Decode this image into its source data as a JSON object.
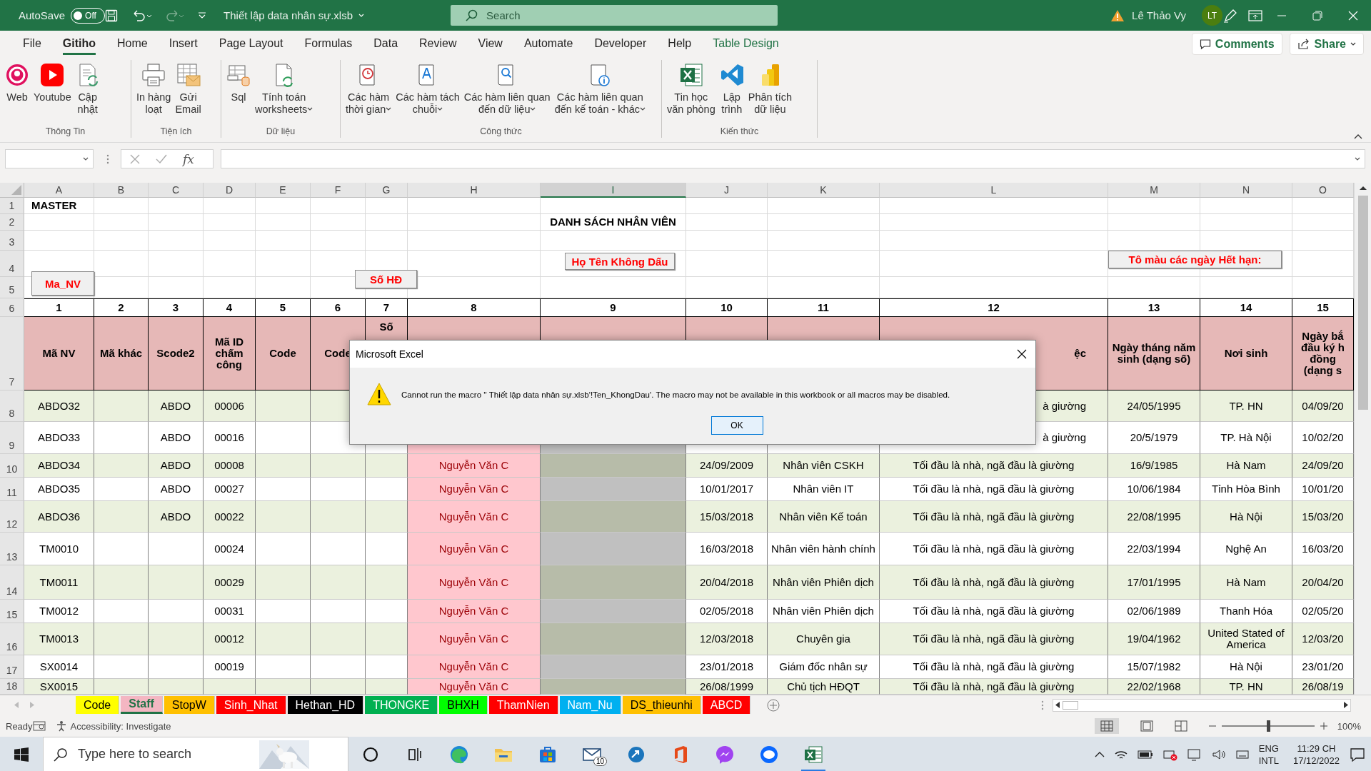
{
  "title_bar": {
    "autosave_label": "AutoSave",
    "autosave": {
      "on": false,
      "label": "Off"
    },
    "document_title": "Thiết lập data nhân sự.xlsb",
    "search": {
      "placeholder": "Search"
    },
    "user_name": "Lê Thảo Vy",
    "avatar_initials": "LT"
  },
  "ribbon_tabs": [
    {
      "label": "File",
      "selected": false,
      "kind": "normal"
    },
    {
      "label": "Gitiho",
      "selected": true,
      "kind": "normal"
    },
    {
      "label": "Home",
      "selected": false,
      "kind": "normal"
    },
    {
      "label": "Insert",
      "selected": false,
      "kind": "normal"
    },
    {
      "label": "Page Layout",
      "selected": false,
      "kind": "normal"
    },
    {
      "label": "Formulas",
      "selected": false,
      "kind": "normal"
    },
    {
      "label": "Data",
      "selected": false,
      "kind": "normal"
    },
    {
      "label": "Review",
      "selected": false,
      "kind": "normal"
    },
    {
      "label": "View",
      "selected": false,
      "kind": "normal"
    },
    {
      "label": "Automate",
      "selected": false,
      "kind": "normal"
    },
    {
      "label": "Developer",
      "selected": false,
      "kind": "normal"
    },
    {
      "label": "Help",
      "selected": false,
      "kind": "normal"
    },
    {
      "label": "Table Design",
      "selected": false,
      "kind": "contextual"
    }
  ],
  "ribbon_actions": {
    "comments": "Comments",
    "share": "Share"
  },
  "ribbon_groups": [
    {
      "label": "Thông Tin",
      "buttons": [
        {
          "label": "Web",
          "dropdown": false
        },
        {
          "label": "Youtube",
          "dropdown": false
        },
        {
          "label": "Cập\nnhật",
          "dropdown": false
        }
      ]
    },
    {
      "label": "Tiện ích",
      "buttons": [
        {
          "label": "In hàng\nloạt",
          "dropdown": false
        },
        {
          "label": "Gửi\nEmail",
          "dropdown": false
        }
      ]
    },
    {
      "label": "Dữ liệu",
      "buttons": [
        {
          "label": "Sql",
          "dropdown": false
        },
        {
          "label": "Tính toán\nworksheets",
          "dropdown": true
        }
      ]
    },
    {
      "label": "Công thức",
      "buttons": [
        {
          "label": "Các hàm\nthời gian",
          "dropdown": true
        },
        {
          "label": "Các hàm tách\nchuỗi",
          "dropdown": true
        },
        {
          "label": "Các hàm liên quan\nđến dữ liệu",
          "dropdown": true
        },
        {
          "label": "Các hàm liên quan\nđến kế toán - khác",
          "dropdown": true
        }
      ]
    },
    {
      "label": "Kiến thức",
      "buttons": [
        {
          "label": "Tin học\nvăn phòng",
          "dropdown": false
        },
        {
          "label": "Lập\ntrình",
          "dropdown": false
        },
        {
          "label": "Phân tích\ndữ liệu",
          "dropdown": false
        }
      ]
    }
  ],
  "formula_bar": {
    "fx_label": "fx"
  },
  "sheet": {
    "columns": [
      {
        "label": "A",
        "selected": false
      },
      {
        "label": "B",
        "selected": false
      },
      {
        "label": "C",
        "selected": false
      },
      {
        "label": "D",
        "selected": false
      },
      {
        "label": "E",
        "selected": false
      },
      {
        "label": "F",
        "selected": false
      },
      {
        "label": "G",
        "selected": false
      },
      {
        "label": "H",
        "selected": false
      },
      {
        "label": "I",
        "selected": true
      },
      {
        "label": "J",
        "selected": false
      },
      {
        "label": "K",
        "selected": false
      },
      {
        "label": "L",
        "selected": false
      },
      {
        "label": "M",
        "selected": false
      },
      {
        "label": "N",
        "selected": false
      },
      {
        "label": "O",
        "selected": false
      }
    ],
    "top_rows": [
      {
        "row": "1"
      },
      {
        "row": "2"
      },
      {
        "row": "3"
      },
      {
        "row": "4"
      },
      {
        "row": "5"
      }
    ],
    "master_label": "MASTER",
    "heading": "DANH SÁCH NHÂN VIÊN",
    "shape_buttons": [
      {
        "label": "Ma_NV"
      },
      {
        "label": "Số HĐ"
      },
      {
        "label": "Họ Tên Không Dấu"
      },
      {
        "label": "Tô màu các ngày Hết hạn:"
      }
    ],
    "number_row": {
      "row": "6",
      "cells": [
        "1",
        "2",
        "3",
        "4",
        "5",
        "6",
        "7",
        "8",
        "9",
        "10",
        "11",
        "12",
        "13",
        "14",
        "15"
      ]
    },
    "header_row": {
      "row": "7",
      "cells": [
        "Mã NV",
        "Mã khác",
        "Scode2",
        "Mã ID chấm công",
        "Code",
        "Code",
        {
          "text": "Số",
          "clipped": true
        },
        null,
        null,
        null,
        null,
        {
          "text": "ệc",
          "clipped": true
        },
        "Ngày tháng năm sinh (dạng số)",
        "Nơi sinh",
        "Ngày bắ đầu ký h đồng (dạng s"
      ]
    },
    "rows": [
      {
        "row": "8",
        "cells": [
          "ABDO32",
          null,
          "ABDO",
          "00006",
          null,
          null,
          null,
          null,
          null,
          null,
          null,
          {
            "text": "à giường",
            "clipped": true
          },
          "24/05/1995",
          "TP. HN",
          "04/09/20"
        ]
      },
      {
        "row": "9",
        "cells": [
          "ABDO33",
          null,
          "ABDO",
          "00016",
          null,
          null,
          null,
          null,
          null,
          null,
          null,
          {
            "text": "à giường",
            "clipped": true
          },
          "20/5/1979",
          "TP. Hà Nội",
          "10/02/20"
        ]
      },
      {
        "row": "10",
        "cells": [
          "ABDO34",
          null,
          "ABDO",
          "00008",
          null,
          null,
          null,
          "Nguyễn Văn C",
          null,
          "24/09/2009",
          "Nhân viên CSKH",
          "Tối đầu là nhà, ngã đầu là giường",
          "16/9/1985",
          "Hà Nam",
          "24/09/20"
        ]
      },
      {
        "row": "11",
        "cells": [
          "ABDO35",
          null,
          "ABDO",
          "00027",
          null,
          null,
          null,
          "Nguyễn Văn C",
          null,
          "10/01/2017",
          "Nhân viên IT",
          "Tối đầu là nhà, ngã đầu là giường",
          "10/06/1984",
          "Tỉnh Hòa Bình",
          "10/01/20"
        ]
      },
      {
        "row": "12",
        "cells": [
          "ABDO36",
          null,
          "ABDO",
          "00022",
          null,
          null,
          null,
          "Nguyễn Văn C",
          null,
          "15/03/2018",
          "Nhân viên Kế toán",
          "Tối đầu là nhà, ngã đầu là giường",
          "22/08/1995",
          "Hà Nội",
          "15/03/20"
        ]
      },
      {
        "row": "13",
        "cells": [
          "TM0010",
          null,
          null,
          "00024",
          null,
          null,
          null,
          "Nguyễn Văn C",
          null,
          "16/03/2018",
          "Nhân viên hành chính",
          "Tối đầu là nhà, ngã đầu là giường",
          "22/03/1994",
          "Nghệ An",
          "16/03/20"
        ]
      },
      {
        "row": "14",
        "cells": [
          "TM0011",
          null,
          null,
          "00029",
          null,
          null,
          null,
          "Nguyễn Văn C",
          null,
          "20/04/2018",
          "Nhân viên Phiên dịch",
          "Tối đầu là nhà, ngã đầu là giường",
          "17/01/1995",
          "Hà Nam",
          "20/04/20"
        ]
      },
      {
        "row": "15",
        "cells": [
          "TM0012",
          null,
          null,
          "00031",
          null,
          null,
          null,
          "Nguyễn Văn C",
          null,
          "02/05/2018",
          "Nhân viên Phiên dịch",
          "Tối đầu là nhà, ngã đầu là giường",
          "02/06/1989",
          "Thanh Hóa",
          "02/05/20"
        ]
      },
      {
        "row": "16",
        "cells": [
          "TM0013",
          null,
          null,
          "00012",
          null,
          null,
          null,
          "Nguyễn Văn C",
          null,
          "12/03/2018",
          "Chuyên gia",
          "Tối đầu là nhà, ngã đầu là giường",
          "19/04/1962",
          "United Stated of America",
          "12/03/20"
        ]
      },
      {
        "row": "17",
        "cells": [
          "SX0014",
          null,
          null,
          "00019",
          null,
          null,
          null,
          "Nguyễn Văn C",
          null,
          "23/01/2018",
          "Giám đốc nhân sự",
          "Tối đầu là nhà, ngã đầu là giường",
          "15/07/1982",
          "Hà Nội",
          "23/01/20"
        ]
      },
      {
        "row": "18",
        "cells": [
          "SX0015",
          null,
          null,
          null,
          null,
          null,
          null,
          "Nguyễn Văn C",
          null,
          "26/08/1999",
          "Chủ tịch HĐQT",
          "Tối đầu là nhà, ngã đầu là giường",
          "22/02/1968",
          "TP. HN",
          "26/08/19"
        ]
      }
    ]
  },
  "dialog": {
    "title": "Microsoft Excel",
    "message": "Cannot run the macro '' Thiết lập data nhân sự.xlsb'!Ten_KhongDau'. The macro may not be available in this workbook or all macros may be disabled.",
    "ok_button": "OK"
  },
  "sheet_tabs": [
    {
      "label": "Code",
      "color": "#ffff00",
      "selected": false
    },
    {
      "label": "Staff",
      "color": "#f4b6c2",
      "selected": true
    },
    {
      "label": "StopW",
      "color": "#ffc000",
      "selected": false
    },
    {
      "label": "Sinh_Nhat",
      "color": "#ff0000",
      "selected": false
    },
    {
      "label": "Hethan_HD",
      "color": "#000000",
      "selected": false
    },
    {
      "label": "THONGKE",
      "color": "#00b050",
      "selected": false
    },
    {
      "label": "BHXH",
      "color": "#00ff00",
      "selected": false
    },
    {
      "label": "ThamNien",
      "color": "#ff0000",
      "selected": false
    },
    {
      "label": "Nam_Nu",
      "color": "#00b0f0",
      "selected": false
    },
    {
      "label": "DS_thieunhi",
      "color": "#ffc000",
      "selected": false
    },
    {
      "label": "ABCD",
      "color": "#ff0000",
      "selected": false
    }
  ],
  "status_bar": {
    "ready": "Ready",
    "accessibility": "Accessibility: Investigate",
    "zoom": {
      "level": 0.5,
      "label": "100%"
    }
  },
  "taskbar": {
    "search_placeholder": "Type here to search",
    "mail_badge": "10",
    "language": "ENG",
    "keyboard": "INTL",
    "time": "11:29 CH",
    "date": "17/12/2022"
  }
}
